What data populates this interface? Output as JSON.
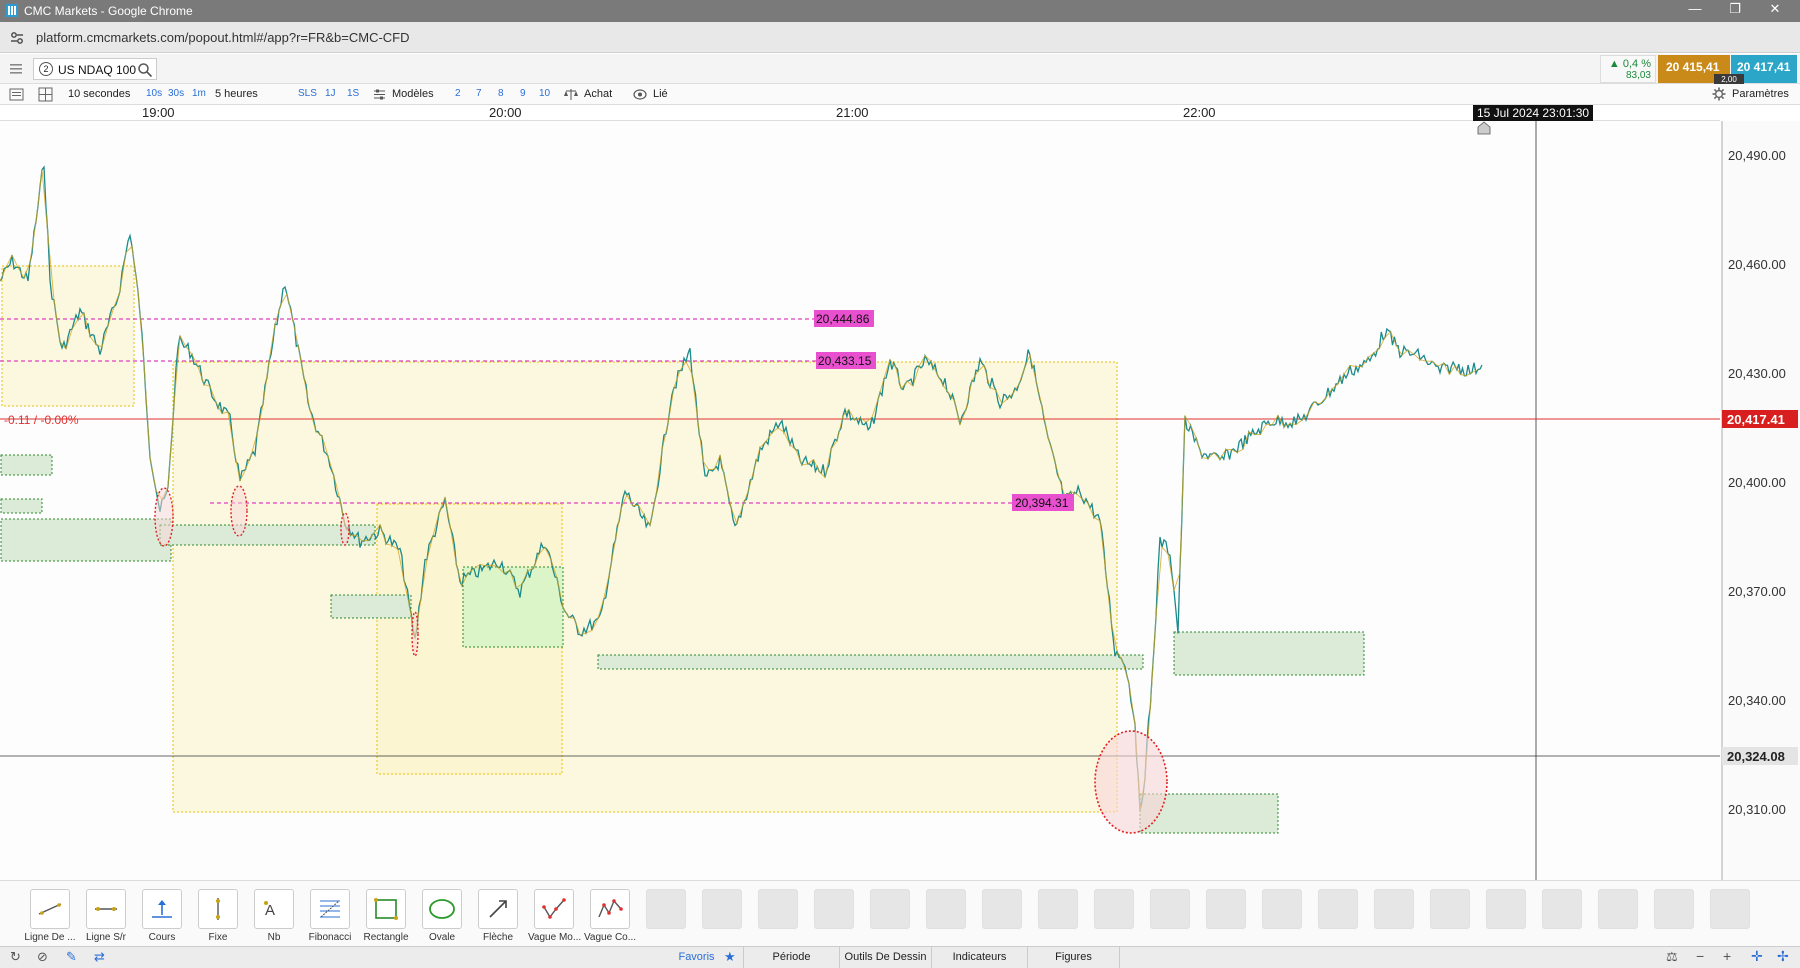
{
  "window": {
    "title": "CMC Markets - Google Chrome",
    "url": "platform.cmcmarkets.com/popout.html#/app?r=FR&b=CMC-CFD"
  },
  "instrument": {
    "tab_number": "2",
    "name": "US NDAQ 100"
  },
  "quote": {
    "change_pct": "▲ 0,4 %",
    "change_pts": "83,03",
    "sell": "20 415,41",
    "buy": "20 417,41",
    "spread": "2,00"
  },
  "toolbar": {
    "interval": "10 secondes",
    "intervals": [
      "10s",
      "30s",
      "1m"
    ],
    "range": "5 heures",
    "sls": "SLS",
    "d1": "1J",
    "d2": "1S",
    "models": "Modèles",
    "counts": [
      "2",
      "7",
      "8",
      "9",
      "10"
    ],
    "buy": "Achat",
    "linked": "Lié",
    "settings": "Paramètres"
  },
  "time_axis": {
    "labels": [
      "19:00",
      "20:00",
      "21:00",
      "22:00"
    ],
    "crosshair_time": "15 Jul 2024 23:01:30"
  },
  "chart": {
    "current_price": "20,417.41",
    "crosshair_price": "20,324.08",
    "change_label": "-0.11 / -0.00%",
    "price_labels": [
      "20,490.00",
      "20,460.00",
      "20,430.00",
      "20,400.00",
      "20,370.00",
      "20,340.00",
      "20,310.00"
    ],
    "level_labels": [
      "20,444.86",
      "20,433.15",
      "20,394.31"
    ],
    "colors": {
      "up": "#1a8a8a",
      "down": "#d4a017",
      "current": "#e03030",
      "level": "#e040c0"
    }
  },
  "draw_tools": [
    {
      "label": "Ligne De ...",
      "icon": "trend-line-icon"
    },
    {
      "label": "Ligne S/r",
      "icon": "sr-line-icon"
    },
    {
      "label": "Cours",
      "icon": "price-line-icon"
    },
    {
      "label": "Fixe",
      "icon": "fixed-line-icon"
    },
    {
      "label": "Nb",
      "icon": "note-icon"
    },
    {
      "label": "Fibonacci",
      "icon": "fibonacci-icon"
    },
    {
      "label": "Rectangle",
      "icon": "rectangle-icon"
    },
    {
      "label": "Ovale",
      "icon": "oval-icon"
    },
    {
      "label": "Flèche",
      "icon": "arrow-icon"
    },
    {
      "label": "Vague Mo...",
      "icon": "wave-icon"
    },
    {
      "label": "Vague Co...",
      "icon": "wave-corrective-icon"
    }
  ],
  "bottom_tabs": [
    "Favoris",
    "Période",
    "Outils De Dessin",
    "Indicateurs",
    "Figures"
  ]
}
